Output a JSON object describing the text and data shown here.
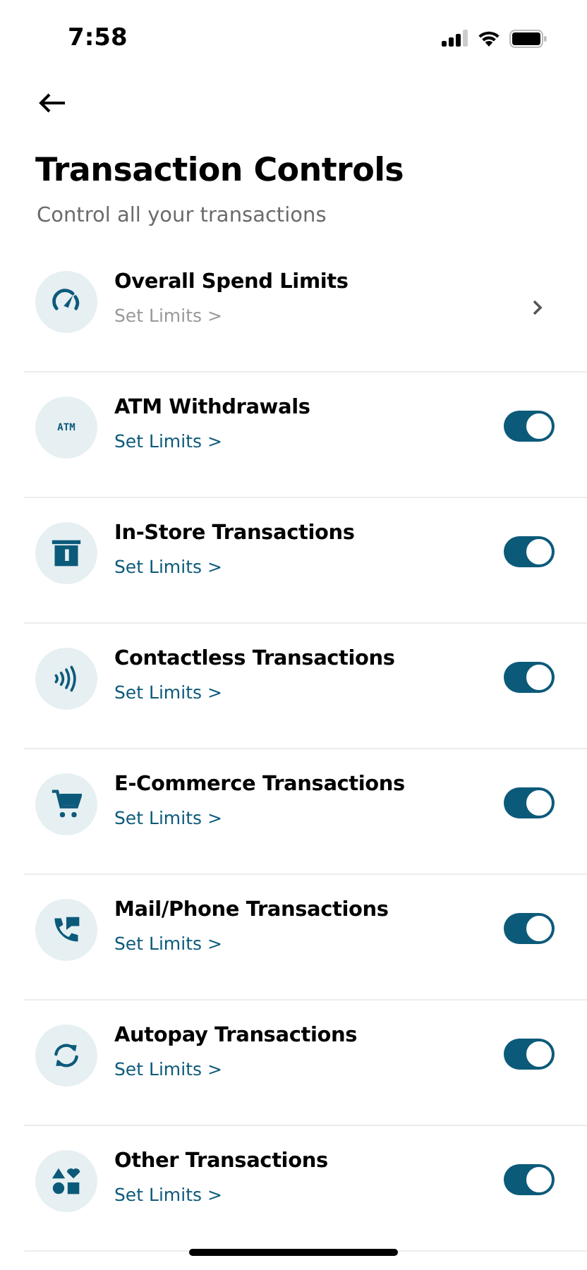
{
  "status_bar": {
    "time": "7:58"
  },
  "header": {
    "title": "Transaction Controls",
    "subtitle": "Control all your transactions"
  },
  "controls": [
    {
      "kind": "chevron",
      "title": "Overall Spend Limits",
      "link": "Set Limits >"
    },
    {
      "kind": "toggle",
      "title": "ATM Withdrawals",
      "link": "Set Limits >",
      "on": true,
      "icon_label": "ATM"
    },
    {
      "kind": "toggle",
      "title": "In-Store Transactions",
      "link": "Set Limits >",
      "on": true
    },
    {
      "kind": "toggle",
      "title": "Contactless Transactions",
      "link": "Set Limits >",
      "on": true
    },
    {
      "kind": "toggle",
      "title": "E-Commerce Transactions",
      "link": "Set Limits >",
      "on": true
    },
    {
      "kind": "toggle",
      "title": "Mail/Phone Transactions",
      "link": "Set Limits >",
      "on": true
    },
    {
      "kind": "toggle",
      "title": "Autopay Transactions",
      "link": "Set Limits >",
      "on": true
    },
    {
      "kind": "toggle",
      "title": "Other Transactions",
      "link": "Set Limits >",
      "on": true
    }
  ]
}
